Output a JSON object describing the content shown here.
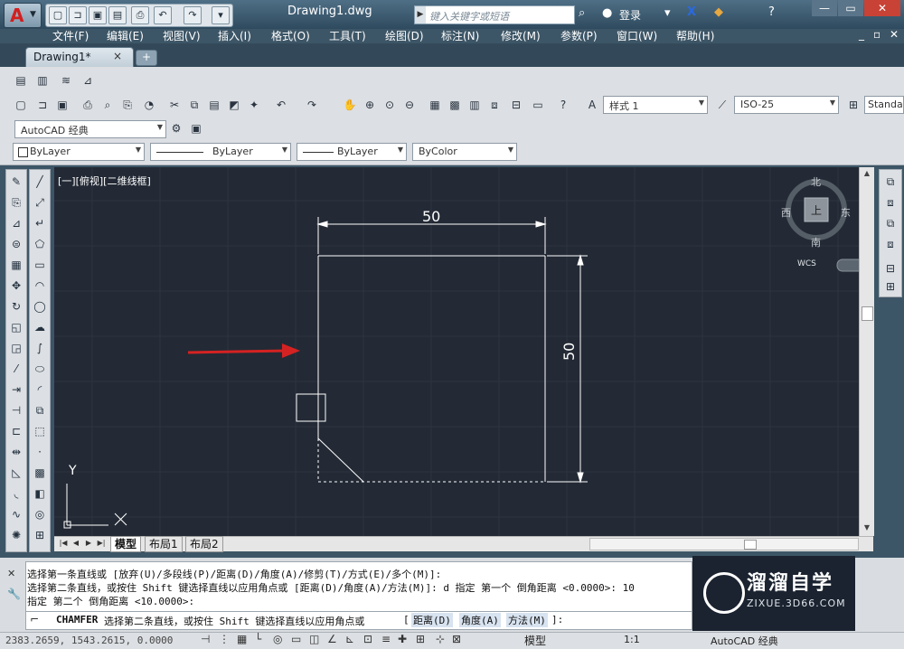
{
  "titlebar": {
    "document_title": "Drawing1.dwg",
    "search_placeholder": "键入关键字或短语",
    "login_label": "登录",
    "quick_access_icons": [
      "new-icon",
      "open-icon",
      "save-icon",
      "saveas-icon",
      "print-icon",
      "undo-icon",
      "redo-icon"
    ]
  },
  "menubar": {
    "items": [
      "文件(F)",
      "编辑(E)",
      "视图(V)",
      "插入(I)",
      "格式(O)",
      "工具(T)",
      "绘图(D)",
      "标注(N)",
      "修改(M)",
      "参数(P)",
      "窗口(W)",
      "帮助(H)"
    ]
  },
  "tabs": {
    "document_tab": "Drawing1*",
    "close_glyph": "×",
    "new_tab_glyph": "+"
  },
  "toolbars": {
    "text_style": "样式 1",
    "dim_style": "ISO-25",
    "table_style": "Standa",
    "workspace": "AutoCAD 经典",
    "layer_color": "ByLayer",
    "linetype": "ByLayer",
    "lineweight": "ByLayer",
    "plot_style": "ByColor"
  },
  "viewport": {
    "view_label": "[一][俯视][二维线框]",
    "dim_horizontal": "50",
    "dim_vertical": "50",
    "ucs_y_label": "Y",
    "ucs_x_label": "X",
    "viewcube": {
      "north": "北",
      "south": "南",
      "west": "西",
      "east": "东",
      "top": "上",
      "wcs": "WCS"
    }
  },
  "layout_tabs": [
    "模型",
    "布局1",
    "布局2"
  ],
  "command": {
    "history": [
      "选择第一条直线或 [放弃(U)/多段线(P)/距离(D)/角度(A)/修剪(T)/方式(E)/多个(M)]:",
      "选择第二条直线，或按住 Shift 键选择直线以应用角点或 [距离(D)/角度(A)/方法(M)]: d 指定 第一个 倒角距离 <0.0000>: 10",
      "指定 第二个 倒角距离 <10.0000>:"
    ],
    "prompt_command": "CHAMFER",
    "prompt_text": "选择第二条直线，或按住 Shift 键选择直线以应用角点或",
    "options": [
      "距离(D)",
      "角度(A)",
      "方法(M)"
    ],
    "prompt_tail": "]:"
  },
  "statusbar": {
    "coordinates": "2383.2659, 1543.2615, 0.0000",
    "model_label": "模型",
    "scale": "1:1",
    "workspace_label": "AutoCAD 经典"
  },
  "watermark": {
    "title": "溜溜自学",
    "url": "ZIXUE.3D66.COM"
  }
}
